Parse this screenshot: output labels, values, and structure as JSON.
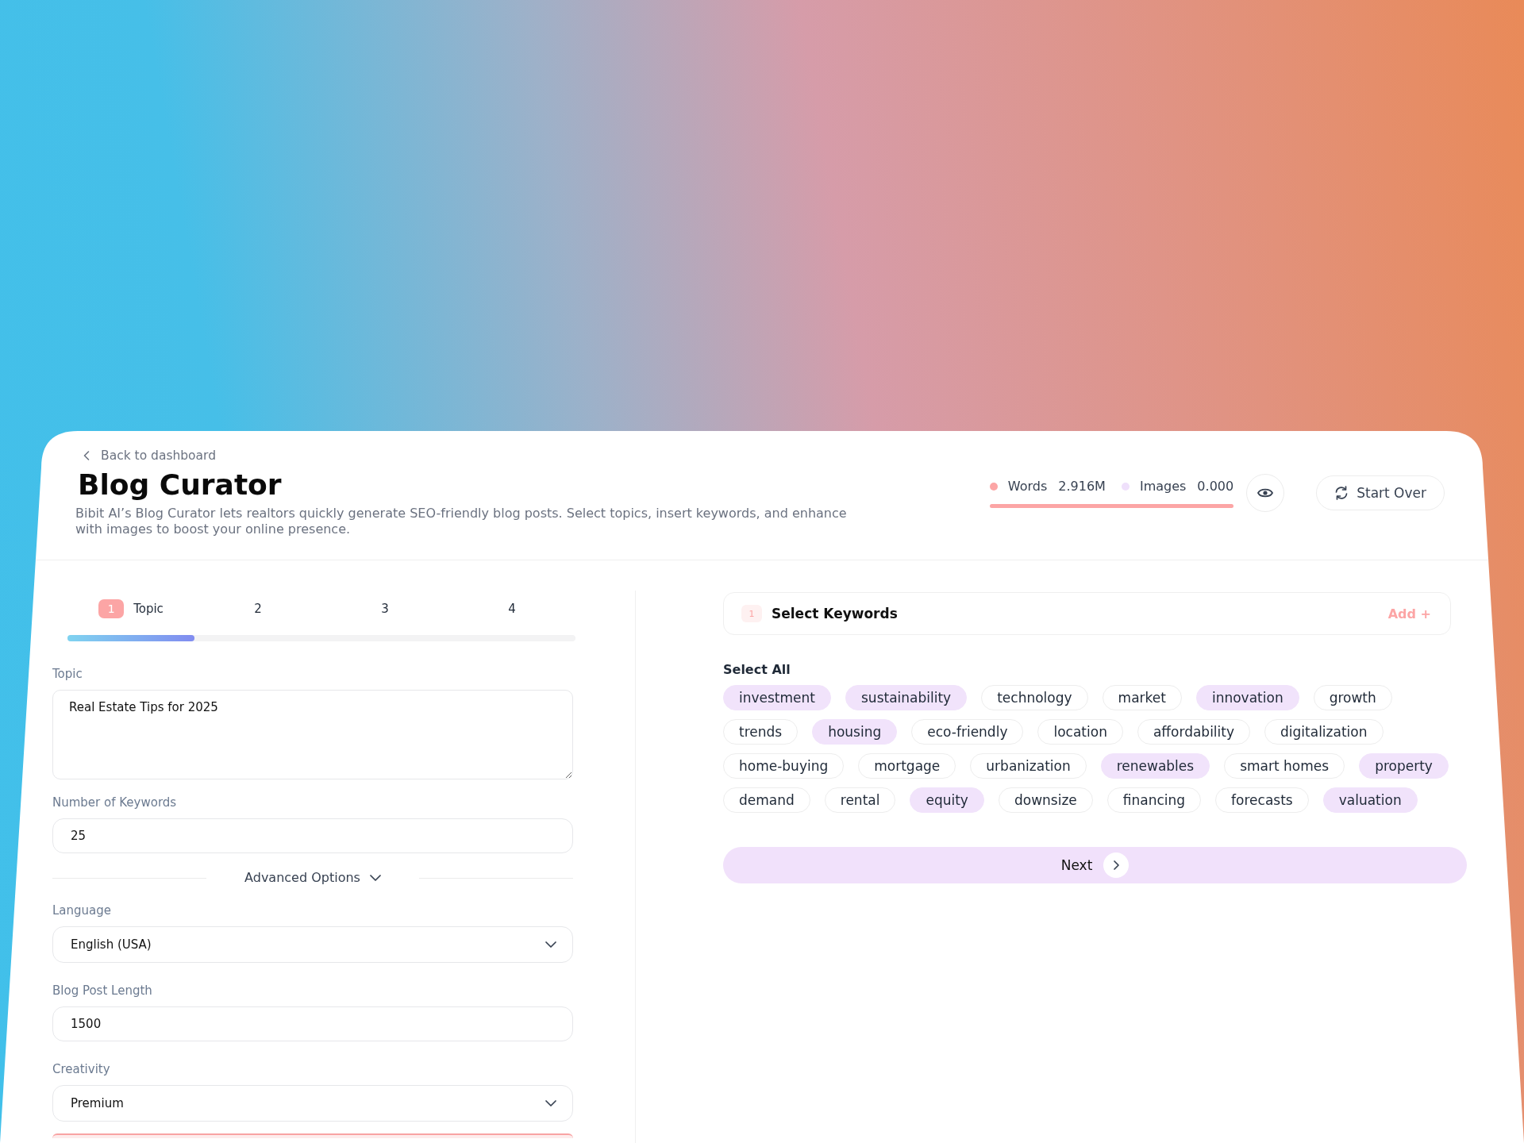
{
  "back_link": {
    "label": "Back to dashboard"
  },
  "header": {
    "title": "Blog Curator",
    "description": "Bibit AI’s Blog Curator lets realtors quickly generate SEO-friendly blog posts. Select topics, insert keywords, and enhance with images to boost your online presence."
  },
  "usage": {
    "items": [
      {
        "label": "Words",
        "value": "2.916M",
        "color": "#fca5a5"
      },
      {
        "label": "Images",
        "value": "0.000",
        "color": "#efe0fb"
      }
    ]
  },
  "actions": {
    "start_over": "Start Over"
  },
  "steps": [
    {
      "number": "1",
      "label": "Topic",
      "selected": true
    },
    {
      "number": "2",
      "selected": false
    },
    {
      "number": "3",
      "selected": false
    },
    {
      "number": "4",
      "selected": false
    }
  ],
  "progress": {
    "level": 0.25
  },
  "form": {
    "fields": [
      {
        "kind": "textarea",
        "label": "Topic",
        "value": "Real Estate Tips for 2025"
      },
      {
        "kind": "input",
        "label": "Number of Keywords",
        "value": "25"
      }
    ],
    "advanced": {
      "label": "Advanced Options",
      "expanded": true,
      "fields": [
        {
          "kind": "select",
          "label": "Language",
          "value": "English (USA)"
        },
        {
          "kind": "input",
          "label": "Blog Post Length",
          "value": "1500"
        },
        {
          "kind": "select",
          "label": "Creativity",
          "value": "Premium"
        }
      ]
    }
  },
  "keywords": {
    "step": "1",
    "title": "Select Keywords",
    "add": "Add +",
    "select_all": "Select All",
    "items": [
      {
        "label": "investment",
        "selected": true
      },
      {
        "label": "sustainability",
        "selected": true
      },
      {
        "label": "technology",
        "selected": false
      },
      {
        "label": "market",
        "selected": false
      },
      {
        "label": "innovation",
        "selected": true
      },
      {
        "label": "growth",
        "selected": false
      },
      {
        "label": "trends",
        "selected": false
      },
      {
        "label": "housing",
        "selected": true
      },
      {
        "label": "eco-friendly",
        "selected": false
      },
      {
        "label": "location",
        "selected": false
      },
      {
        "label": "affordability",
        "selected": false
      },
      {
        "label": "digitalization",
        "selected": false
      },
      {
        "label": "home-buying",
        "selected": false
      },
      {
        "label": "mortgage",
        "selected": false
      },
      {
        "label": "urbanization",
        "selected": false
      },
      {
        "label": "renewables",
        "selected": true
      },
      {
        "label": "smart homes",
        "selected": false
      },
      {
        "label": "property",
        "selected": true
      },
      {
        "label": "demand",
        "selected": false
      },
      {
        "label": "rental",
        "selected": false
      },
      {
        "label": "equity",
        "selected": true
      },
      {
        "label": "downsize",
        "selected": false
      },
      {
        "label": "financing",
        "selected": false
      },
      {
        "label": "forecasts",
        "selected": false
      },
      {
        "label": "valuation",
        "selected": true
      }
    ]
  },
  "next_button": {
    "label": "Next"
  }
}
